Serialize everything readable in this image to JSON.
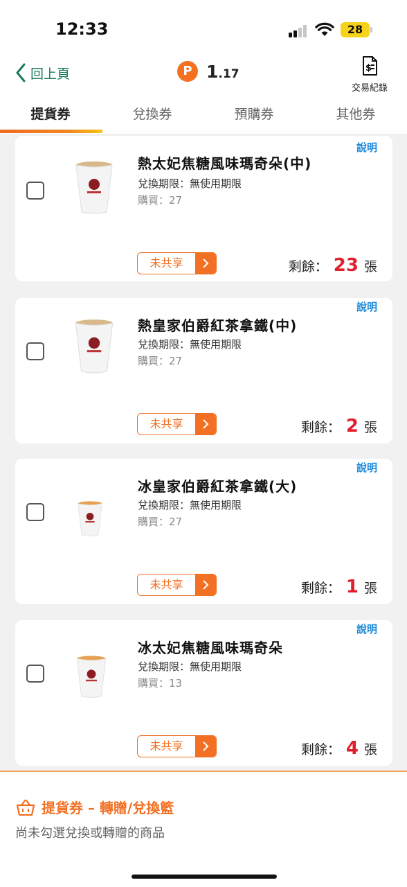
{
  "status": {
    "time": "12:33",
    "battery": "28"
  },
  "nav": {
    "back_label": "回上頁",
    "points_icon": "P",
    "points_int": "1",
    "points_dec": ".17",
    "transactions_label": "交易紀錄"
  },
  "tabs": [
    {
      "label": "提貨券",
      "active": true
    },
    {
      "label": "兌換券",
      "active": false
    },
    {
      "label": "預購券",
      "active": false
    },
    {
      "label": "其他券",
      "active": false
    }
  ],
  "items": [
    {
      "title": "熱太妃焦糖風味瑪奇朵(中)",
      "expiry": "兌換期限：無使用期限",
      "purchase": "購買：27",
      "explain": "說明",
      "share": "未共享",
      "remain_prefix": "剩餘：",
      "remain_count": "23",
      "remain_unit": "張",
      "cup": "hot"
    },
    {
      "title": "熱皇家伯爵紅茶拿鐵(中)",
      "expiry": "兌換期限：無使用期限",
      "purchase": "購買：27",
      "explain": "說明",
      "share": "未共享",
      "remain_prefix": "剩餘：",
      "remain_count": "2",
      "remain_unit": "張",
      "cup": "hot"
    },
    {
      "title": "冰皇家伯爵紅茶拿鐵(大)",
      "expiry": "兌換期限：無使用期限",
      "purchase": "購買：27",
      "explain": "說明",
      "share": "未共享",
      "remain_prefix": "剩餘：",
      "remain_count": "1",
      "remain_unit": "張",
      "cup": "iced"
    },
    {
      "title": "冰太妃焦糖風味瑪奇朵",
      "expiry": "兌換期限：無使用期限",
      "purchase": "購買：13",
      "explain": "說明",
      "share": "未共享",
      "remain_prefix": "剩餘：",
      "remain_count": "4",
      "remain_unit": "張",
      "cup": "iced"
    }
  ],
  "basket": {
    "title": "提貨券 – 轉贈/兌換籃",
    "desc": "尚未勾選兌換或轉贈的商品"
  },
  "colors": {
    "accent": "#f27024",
    "count": "#e01e2c",
    "link": "#1f8ad8",
    "back": "#1a7a5b"
  }
}
